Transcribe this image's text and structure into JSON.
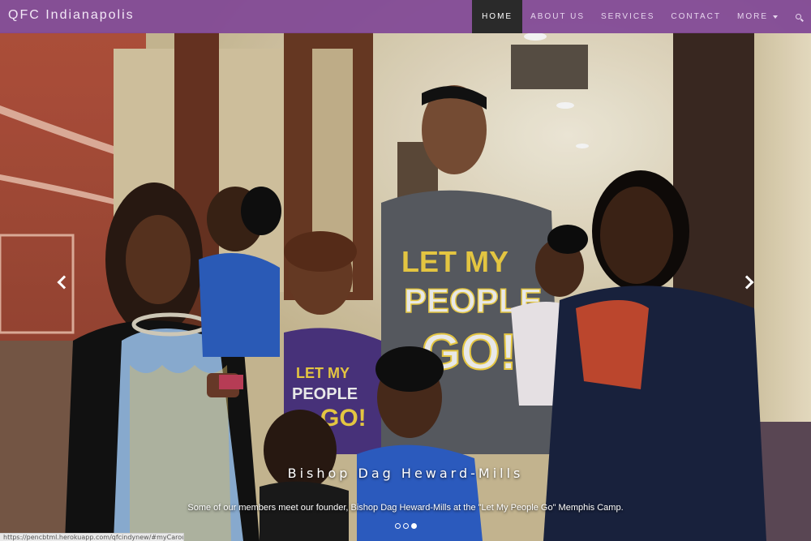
{
  "navbar": {
    "brand": "QFC Indianapolis",
    "items": [
      {
        "label": "HOME",
        "active": true
      },
      {
        "label": "ABOUT US",
        "active": false
      },
      {
        "label": "SERVICES",
        "active": false
      },
      {
        "label": "CONTACT",
        "active": false
      },
      {
        "label": "MORE",
        "active": false,
        "dropdown": true
      }
    ],
    "search_icon": "search-icon",
    "color": "#804696"
  },
  "carousel": {
    "photo_subject": "group-photo",
    "caption_title": "Bishop Dag Heward-Mills",
    "caption_text": "Some of our members meet our founder, Bishop Dag Heward-Mills at the \"Let My People Go\" Memphis Camp.",
    "shirt_text": [
      "LET MY",
      "PEOPLE",
      "GO!"
    ],
    "prev_icon": "chevron-left-icon",
    "next_icon": "chevron-right-icon",
    "indicators": [
      {
        "active": false
      },
      {
        "active": false
      },
      {
        "active": true
      }
    ]
  },
  "statusbar": {
    "url": "https://pencbtml.herokuapp.com/qfcindynew/#myCarousel"
  }
}
